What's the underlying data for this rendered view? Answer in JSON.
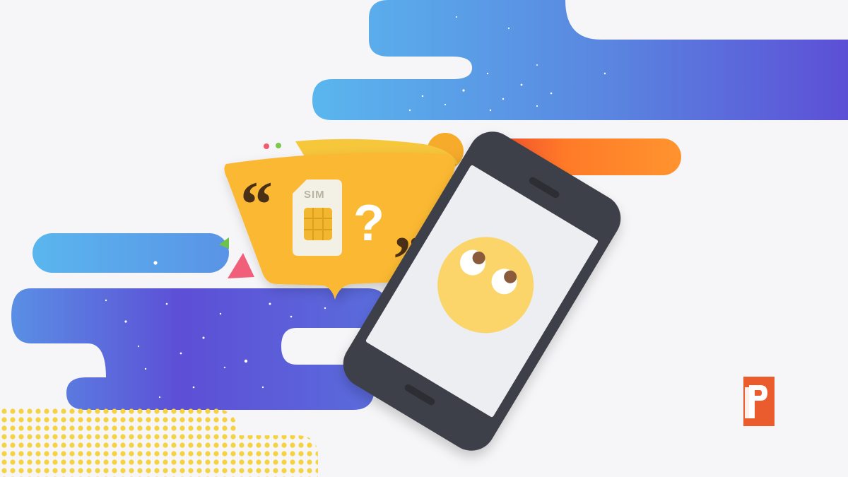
{
  "illustration": {
    "sim_card_label": "SIM",
    "bubble_question": "?",
    "bubble_open_quote": "“",
    "bubble_close_quote": "”"
  },
  "colors": {
    "background": "#f6f6f8",
    "cloud_light_blue": "#5ab2ec",
    "cloud_purple": "#5c4fd6",
    "bubble_yellow": "#fbb833",
    "phone_body": "#3e4149",
    "phone_screen": "#eceef1",
    "emoji_face": "#fbd56a",
    "accent_orange": "#ff8a2a",
    "accent_red": "#ef4a2e",
    "dots_yellow": "#f7d23c",
    "logo_orange": "#ea5b2d"
  },
  "icons": {
    "sim": "sim-card-icon",
    "question": "question-mark-icon",
    "emoji": "eyes-rolling-emoji-icon",
    "logo": "payette-forward-logo-icon"
  }
}
